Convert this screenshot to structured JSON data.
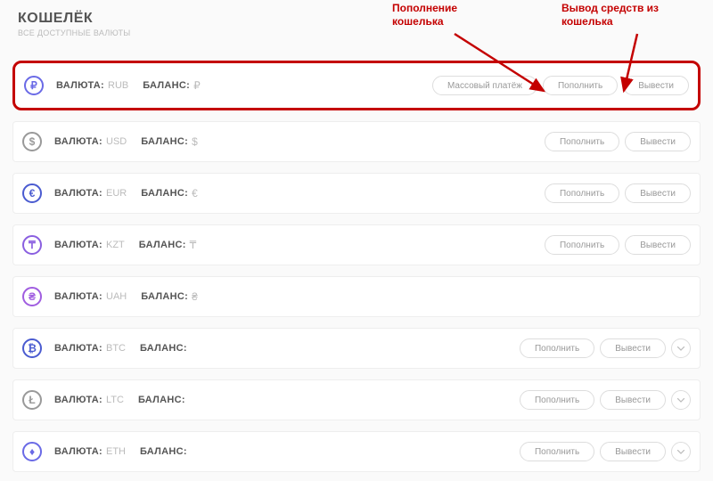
{
  "header": {
    "title": "КОШЕЛЁК",
    "subtitle": "ВСЕ ДОСТУПНЫЕ ВАЛЮТЫ"
  },
  "labels": {
    "currency": "ВАЛЮТА:",
    "balance": "БАЛАНС:"
  },
  "buttons": {
    "mass_payment": "Массовый платёж",
    "deposit": "Пополнить",
    "withdraw": "Вывести"
  },
  "annotations": {
    "deposit": "Пополнение кошелька",
    "withdraw": "Вывод средств из кошелька"
  },
  "rows": [
    {
      "code": "RUB",
      "symbol": "₽",
      "icon": "₽",
      "color": "#6a6ae6",
      "highlight": true,
      "has_mass": true,
      "has_deposit": true,
      "has_withdraw": true,
      "has_expand": false
    },
    {
      "code": "USD",
      "symbol": "$",
      "icon": "$",
      "color": "#999999",
      "highlight": false,
      "has_mass": false,
      "has_deposit": true,
      "has_withdraw": true,
      "has_expand": false
    },
    {
      "code": "EUR",
      "symbol": "€",
      "icon": "€",
      "color": "#4a5bd0",
      "highlight": false,
      "has_mass": false,
      "has_deposit": true,
      "has_withdraw": true,
      "has_expand": false
    },
    {
      "code": "KZT",
      "symbol": "₸",
      "icon": "₸",
      "color": "#8a5fe0",
      "highlight": false,
      "has_mass": false,
      "has_deposit": true,
      "has_withdraw": true,
      "has_expand": false
    },
    {
      "code": "UAH",
      "symbol": "₴",
      "icon": "₴",
      "color": "#a05de0",
      "highlight": false,
      "has_mass": false,
      "has_deposit": false,
      "has_withdraw": false,
      "has_expand": false
    },
    {
      "code": "BTC",
      "symbol": "",
      "icon": "₿",
      "color": "#4a5bd0",
      "highlight": false,
      "has_mass": false,
      "has_deposit": true,
      "has_withdraw": true,
      "has_expand": true
    },
    {
      "code": "LTC",
      "symbol": "",
      "icon": "Ł",
      "color": "#999999",
      "highlight": false,
      "has_mass": false,
      "has_deposit": true,
      "has_withdraw": true,
      "has_expand": true
    },
    {
      "code": "ETH",
      "symbol": "",
      "icon": "♦",
      "color": "#6a6ae6",
      "highlight": false,
      "has_mass": false,
      "has_deposit": true,
      "has_withdraw": true,
      "has_expand": true
    }
  ]
}
